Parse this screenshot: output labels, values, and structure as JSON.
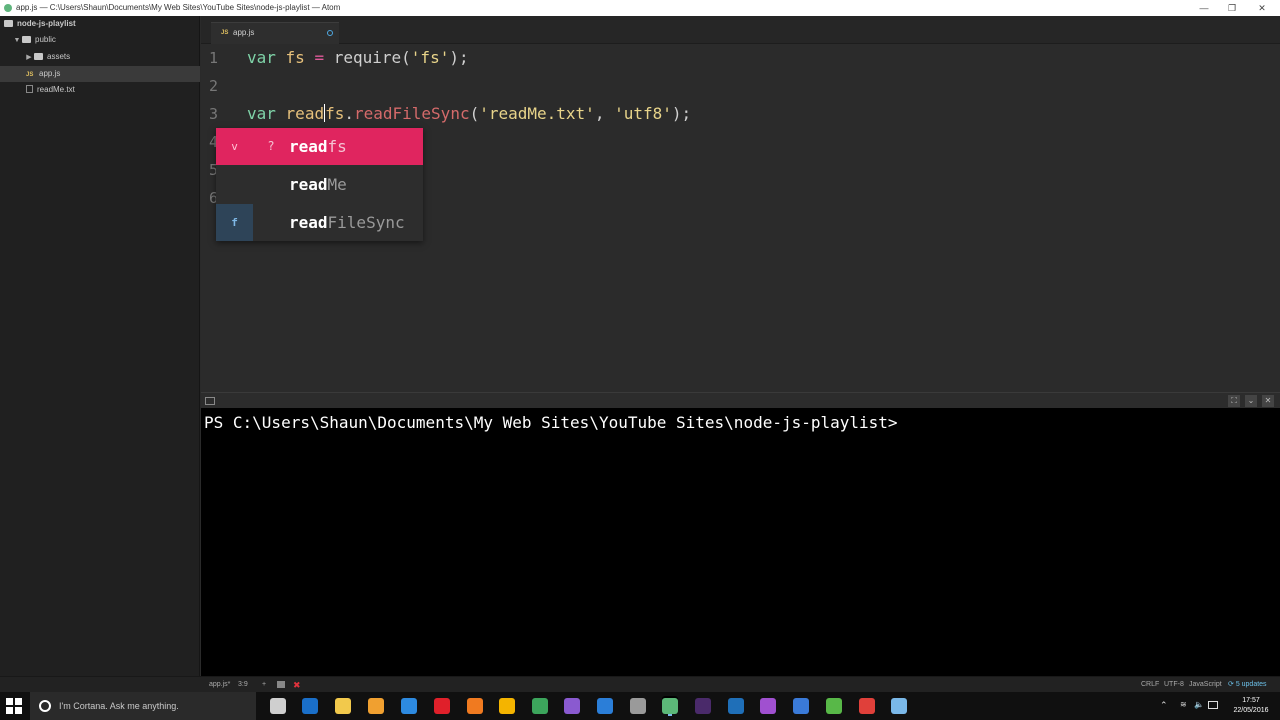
{
  "window": {
    "title": "app.js — C:\\Users\\Shaun\\Documents\\My Web Sites\\YouTube Sites\\node-js-playlist — Atom",
    "minimize_glyph": "—",
    "restore_glyph": "❐",
    "close_glyph": "✕"
  },
  "tree": {
    "root": "node-js-playlist",
    "items": [
      {
        "label": "public",
        "kind": "folder",
        "expanded": true
      },
      {
        "label": "assets",
        "kind": "folder",
        "expanded": false
      },
      {
        "label": "app.js",
        "kind": "js",
        "selected": true
      },
      {
        "label": "readMe.txt",
        "kind": "text"
      }
    ]
  },
  "tabs": [
    {
      "label": "app.js",
      "icon": "js-file-icon",
      "modified": true
    }
  ],
  "editor": {
    "line_numbers": [
      "1",
      "2",
      "3",
      "4",
      "5",
      "6"
    ],
    "lines": [
      {
        "tokens": [
          {
            "t": "var",
            "c": "kw"
          },
          {
            "t": " ",
            "c": "pl"
          },
          {
            "t": "fs",
            "c": "id"
          },
          {
            "t": " ",
            "c": "pl"
          },
          {
            "t": "=",
            "c": "op"
          },
          {
            "t": " require(",
            "c": "pl"
          },
          {
            "t": "'fs'",
            "c": "str"
          },
          {
            "t": ");",
            "c": "pl"
          }
        ]
      },
      {
        "tokens": []
      },
      {
        "tokens": [
          {
            "t": "var",
            "c": "kw"
          },
          {
            "t": " ",
            "c": "pl"
          },
          {
            "t": "read",
            "c": "id"
          },
          {
            "t": "|",
            "c": "cursor"
          },
          {
            "t": "fs",
            "c": "id"
          },
          {
            "t": ".",
            "c": "pl"
          },
          {
            "t": "readFileSync",
            "c": "fn"
          },
          {
            "t": "(",
            "c": "pl"
          },
          {
            "t": "'readMe.txt'",
            "c": "str"
          },
          {
            "t": ", ",
            "c": "pl"
          },
          {
            "t": "'utf8'",
            "c": "str"
          },
          {
            "t": ");",
            "c": "pl"
          }
        ]
      }
    ]
  },
  "autocomplete": {
    "items": [
      {
        "type": "v",
        "left": "?",
        "match": "read",
        "rest": "fs",
        "selected": true
      },
      {
        "type": "",
        "left": "",
        "match": "read",
        "rest": "Me",
        "selected": false
      },
      {
        "type": "f",
        "left": "",
        "match": "read",
        "rest": "FileSync",
        "selected": false
      }
    ]
  },
  "terminal": {
    "prompt": "PS C:\\Users\\Shaun\\Documents\\My Web Sites\\YouTube Sites\\node-js-playlist>"
  },
  "status": {
    "file": "app.js*",
    "cursor_pos": "3:9",
    "add": "+",
    "error_glyph": "✖",
    "line_ending": "CRLF",
    "encoding": "UTF-8",
    "grammar": "JavaScript",
    "updates": "5 updates"
  },
  "taskbar": {
    "cortana_placeholder": "I'm Cortana. Ask me anything.",
    "time": "17:57",
    "date": "22/05/2016",
    "apps": [
      {
        "name": "task-view-icon",
        "color": "#cfcfcf"
      },
      {
        "name": "outlook-icon",
        "color": "#1a6fc9"
      },
      {
        "name": "file-explorer-icon",
        "color": "#f2c94c"
      },
      {
        "name": "store-icon",
        "color": "#f0a030"
      },
      {
        "name": "edge-icon",
        "color": "#2d8ae0"
      },
      {
        "name": "opera-icon",
        "color": "#e0202a"
      },
      {
        "name": "firefox-icon",
        "color": "#f07a20"
      },
      {
        "name": "chrome-canary-icon",
        "color": "#f4b400"
      },
      {
        "name": "chrome-icon",
        "color": "#3ca55c"
      },
      {
        "name": "visual-studio-icon",
        "color": "#8a5ad0"
      },
      {
        "name": "sourcetree-icon",
        "color": "#2b7ed8"
      },
      {
        "name": "sublime-icon",
        "color": "#9a9a9a"
      },
      {
        "name": "atom-icon",
        "color": "#5cb878"
      },
      {
        "name": "premiere-icon",
        "color": "#4a2a6a"
      },
      {
        "name": "photoshop-icon",
        "color": "#1f6fb8"
      },
      {
        "name": "obs-icon",
        "color": "#a050d0"
      },
      {
        "name": "media-player-icon",
        "color": "#3a7ad8"
      },
      {
        "name": "shield-app-icon",
        "color": "#58b848"
      },
      {
        "name": "todoist-icon",
        "color": "#e0403a"
      },
      {
        "name": "notes-icon",
        "color": "#7ab8e8"
      }
    ]
  }
}
